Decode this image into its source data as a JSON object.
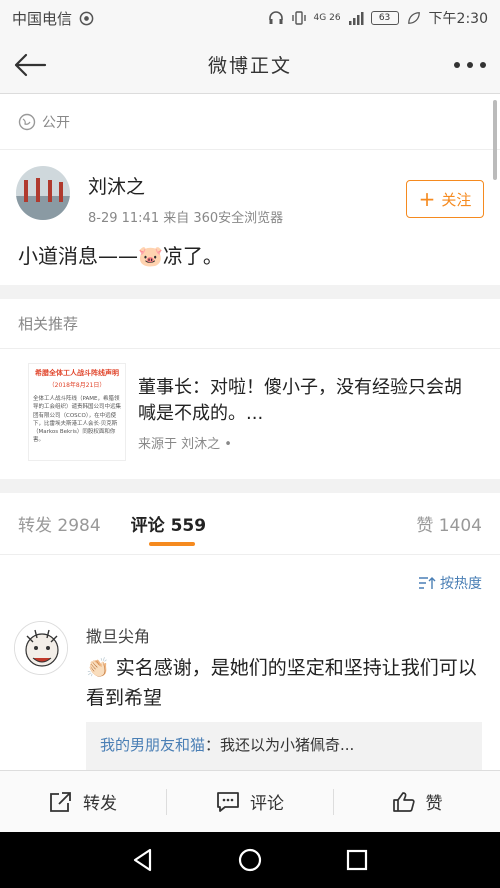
{
  "status_bar": {
    "carrier": "中国电信",
    "signal_label": "4G 26",
    "battery": "63",
    "time": "下午2:30"
  },
  "nav": {
    "title": "微博正文"
  },
  "post": {
    "visibility": "公开",
    "author": "刘沐之",
    "meta": "8-29 11:41  来自 360安全浏览器",
    "follow_label": "关注",
    "text": "小道消息——🐷凉了。"
  },
  "related": {
    "section_title": "相关推荐",
    "thumb_title": "希腊全体工人战斗阵线声明",
    "thumb_date": "（2018年8月21日）",
    "thumb_body": "全体工人战斗阵线（PAME，希腊领导的工会组织）谴责韩国公司中远集团有限公司（COSCO），在中远使下，比雷埃夫斯港工人会长·贝克斯（Markos Bekris）同股权面和你害。",
    "headline": "董事长：对啦！傻小子，没有经验只会胡喊是不成的。...",
    "source": "来源于 刘沐之 •"
  },
  "counts": {
    "reposts": "转发 2984",
    "comments": "评论 559",
    "likes": "赞 1404"
  },
  "comments": {
    "sort_label": "按热度",
    "items": [
      {
        "name": "撒旦尖角",
        "text": "👏🏻 实名感谢，是她们的坚定和坚持让我们可以看到希望",
        "reply_user": "我的男朋友和猫",
        "reply_text": "：我还以为小猪佩奇..."
      }
    ]
  },
  "bottom": {
    "repost": "转发",
    "comment": "评论",
    "like": "赞"
  },
  "colors": {
    "accent": "#f58a1f",
    "link": "#4a7fb5"
  }
}
